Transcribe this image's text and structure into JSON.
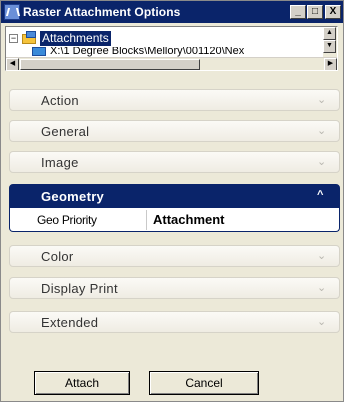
{
  "window": {
    "title": "Raster Attachment Options",
    "controls": {
      "minimize": "_",
      "maximize": "□",
      "close": "X"
    }
  },
  "tree": {
    "root_expander": "−",
    "root_label": "Attachments",
    "child_path": "X:\\1 Degree Blocks\\Mellory\\001120\\Nex",
    "scroll_left": "◀",
    "scroll_right": "▶",
    "scroll_up": "▲",
    "scroll_down": "▼"
  },
  "sections": [
    {
      "label": "Action",
      "expanded": false
    },
    {
      "label": "General",
      "expanded": false
    },
    {
      "label": "Image",
      "expanded": false
    },
    {
      "label": "Geometry",
      "expanded": true
    },
    {
      "label": "Color",
      "expanded": false
    },
    {
      "label": "Display Print",
      "expanded": false
    },
    {
      "label": "Extended",
      "expanded": false
    }
  ],
  "geometry_props": [
    {
      "name": "Geo Priority",
      "value": "Attachment"
    }
  ],
  "chevrons": {
    "collapsed": "⌄",
    "expanded": "^"
  },
  "buttons": {
    "attach": "Attach",
    "cancel": "Cancel"
  },
  "colors": {
    "title_bar": "#0a246a",
    "active_section": "#0a246a",
    "face": "#ece9d8"
  }
}
